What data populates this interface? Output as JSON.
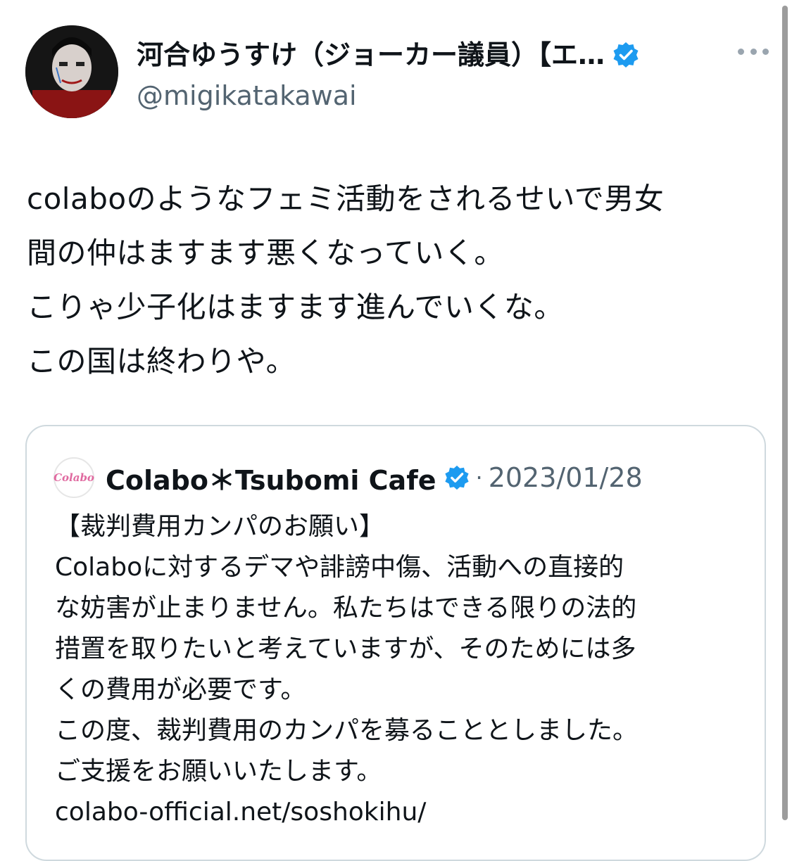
{
  "author": {
    "display_name": "河合ゆうすけ（ジョーカー議員）【エ…",
    "handle": "@migikatakawai",
    "verified_icon": "verified-badge-icon",
    "more_icon": "more-options-icon"
  },
  "tweet": {
    "lines": [
      "colaboのようなフェミ活動をされるせいで男女",
      "間の仲はますます悪くなっていく。",
      "こりゃ少子化はますます進んでいくな。",
      "この国は終わりや。"
    ]
  },
  "quote": {
    "avatar_text": "Colabo",
    "name": "Colabo＊Tsubomi Cafe",
    "separator": "·",
    "date": "2023/01/28",
    "lines": [
      "【裁判費用カンパのお願い】",
      "Colaboに対するデマや誹謗中傷、活動への直接的",
      "な妨害が止まりません。私たちはできる限りの法的",
      "措置を取りたいと考えていますが、そのためには多",
      "くの費用が必要です。",
      "この度、裁判費用のカンパを募ることとしました。",
      "ご支援をお願いいたします。",
      "colabo-official.net/soshokihu/"
    ]
  },
  "colors": {
    "text": "#0f1419",
    "muted": "#536471",
    "verified": "#1d9bf0",
    "border": "#cfd9de"
  }
}
